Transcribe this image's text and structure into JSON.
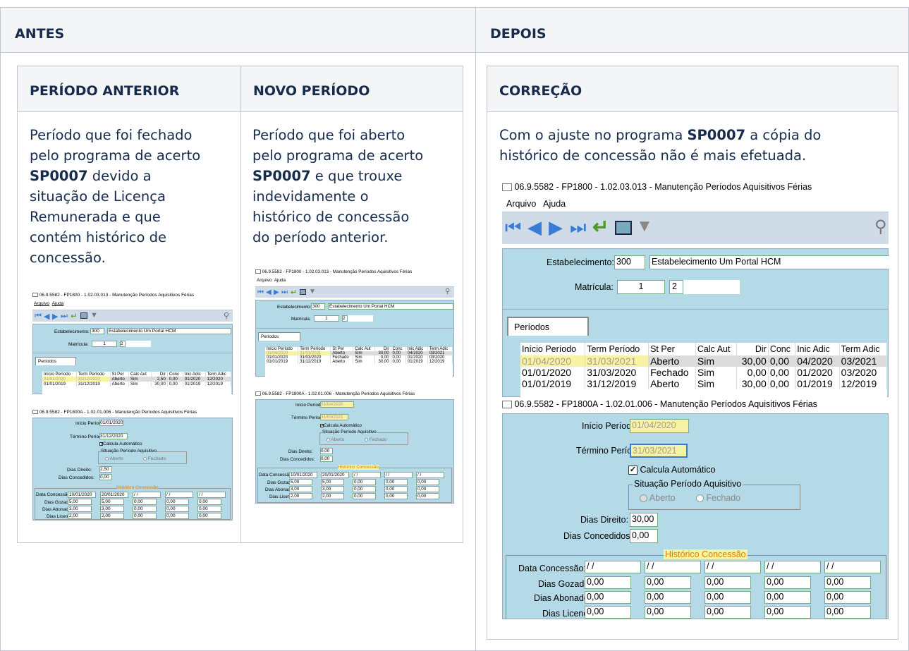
{
  "antes": "ANTES",
  "depois": "DEPOIS",
  "col_anterior": {
    "title": "PERÍODO ANTERIOR",
    "lines": [
      "Período que foi fechado",
      "pelo programa de acerto"
    ],
    "bold": "SP0007",
    "after_bold": " devido a",
    "rest": [
      "situação de Licença",
      "Remunerada e que",
      "contém histórico de",
      "concessão."
    ]
  },
  "col_novo": {
    "title": "NOVO PERÍODO",
    "lines": [
      "Período que foi aberto",
      "pelo programa de acerto"
    ],
    "bold": "SP0007",
    "after_bold": " e que trouxe",
    "rest": [
      "indevidamente o",
      "histórico de concessão",
      "do período anterior."
    ]
  },
  "col_correcao": {
    "title": "CORREÇÃO",
    "line1_pre": "Com o ajuste no programa ",
    "bold": "SP0007",
    "line1_post": " a cópia do",
    "line2": "histórico de concessão não é mais efetuada."
  },
  "app": {
    "title1": "06.9.5582 - FP1800 - 1.02.03.013 - Manutenção Períodos Aquisitivos Férias",
    "title2": "06.9.5582 - FP1800A - 1.02.01.006 - Manutenção Períodos Aquisitivos Férias",
    "menu_arquivo": "Arquivo",
    "menu_ajuda": "Ajuda",
    "estab_label": "Estabelecimento:",
    "estab_value": "300",
    "estab_name": "Estabelecimento Um Portal HCM",
    "matricula_label": "Matrícula:",
    "matricula_value": "1",
    "matricula_seq": "2",
    "tab_periodos": "Períodos",
    "cols": [
      "Início Período",
      "Term Período",
      "St Per",
      "Calc Aut",
      "Dir",
      "Conc",
      "Inic Adic",
      "Term Adic"
    ],
    "inicio_label": "Início Período:",
    "termino_label": "Término Período:",
    "calcula": "Calcula Automático",
    "situacao": "Situação Período Aquisitivo",
    "aberto": "Aberto",
    "fechado": "Fechado",
    "dias_direito_label": "Dias Direito:",
    "dias_concedidos_label": "Dias Concedidos:",
    "historico": "Histórico Concessão",
    "data_concessao_label": "Data Concessão:",
    "dias_gozados_label": "Dias Gozados:",
    "dias_abonados_label": "Dias Abonados:",
    "dias_licenca_label": "Dias Licença:",
    "empty_date": " / /"
  },
  "shot_anterior": {
    "rows": [
      [
        "01/01/2020",
        "31/12/2020",
        "Aberto",
        "Sim",
        "2,50",
        "0,00",
        "01/2020",
        "12/2020"
      ],
      [
        "01/01/2019",
        "31/12/2019",
        "Aberto",
        "Sim",
        "30,00",
        "0,00",
        "01/2019",
        "12/2019"
      ]
    ],
    "inicio": "01/01/2020",
    "termino": "31/12/2020",
    "dias_direito": "2,50",
    "dias_concedidos": "0,00",
    "data_concessao": [
      "10/01/2020",
      "20/01/2020",
      " / /",
      " / /",
      " / /"
    ],
    "gozados": [
      "5,00",
      "5,00",
      "0,00",
      "0,00",
      "0,00"
    ],
    "abonados": [
      "3,00",
      "3,00",
      "0,00",
      "0,00",
      "0,00"
    ],
    "licenca": [
      "2,00",
      "2,00",
      "0,00",
      "0,00",
      "0,00"
    ]
  },
  "shot_novo": {
    "rows": [
      [
        "01/04/2020",
        "31/03/2021",
        "Aberto",
        "Sim",
        "30,00",
        "0,00",
        "04/2020",
        "03/2021"
      ],
      [
        "01/01/2020",
        "31/03/2020",
        "Fechado",
        "Sim",
        "0,00",
        "0,00",
        "01/2020",
        "03/2020"
      ],
      [
        "01/01/2019",
        "31/12/2019",
        "Aberto",
        "Sim",
        "30,00",
        "0,00",
        "01/2019",
        "12/2019"
      ]
    ],
    "inicio": "01/04/2020",
    "termino": "31/03/2021",
    "dias_direito": "0,00",
    "dias_concedidos": "0,00",
    "data_concessao": [
      "10/01/2020",
      "20/01/2020",
      " / /",
      " / /",
      " / /"
    ],
    "gozados": [
      "5,00",
      "5,00",
      "0,00",
      "0,00",
      "0,00"
    ],
    "abonados": [
      "3,00",
      "3,00",
      "0,00",
      "0,00",
      "0,00"
    ],
    "licenca": [
      "2,00",
      "2,00",
      "0,00",
      "0,00",
      "0,00"
    ]
  },
  "shot_correcao": {
    "rows": [
      [
        "01/04/2020",
        "31/03/2021",
        "Aberto",
        "Sim",
        "30,00",
        "0,00",
        "04/2020",
        "03/2021"
      ],
      [
        "01/01/2020",
        "31/03/2020",
        "Fechado",
        "Sim",
        "0,00",
        "0,00",
        "01/2020",
        "03/2020"
      ],
      [
        "01/01/2019",
        "31/12/2019",
        "Aberto",
        "Sim",
        "30,00",
        "0,00",
        "01/2019",
        "12/2019"
      ]
    ],
    "inicio": "01/04/2020",
    "termino": "31/03/2021",
    "dias_direito": "30,00",
    "dias_concedidos": "0,00",
    "data_concessao": [
      " / /",
      " / /",
      " / /",
      " / /",
      " / /"
    ],
    "gozados": [
      "0,00",
      "0,00",
      "0,00",
      "0,00",
      "0,00"
    ],
    "abonados": [
      "0,00",
      "0,00",
      "0,00",
      "0,00",
      "0,00"
    ],
    "licenca": [
      "0,00",
      "0,00",
      "0,00",
      "0,00",
      "0,00"
    ]
  }
}
